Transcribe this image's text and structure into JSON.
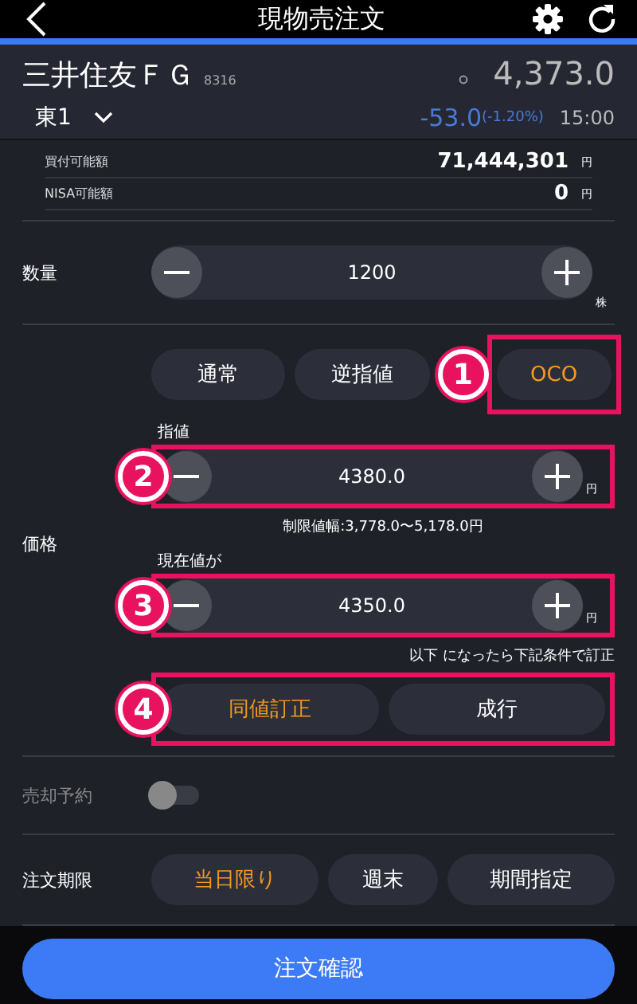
{
  "header": {
    "title": "現物売注文"
  },
  "stock": {
    "name": "三井住友ＦＧ",
    "code": "8316",
    "price": "4,373.0",
    "market": "東1",
    "change": "-53.0",
    "change_pct": "(-1.20%)",
    "time": "15:00"
  },
  "balances": [
    {
      "label": "買付可能額",
      "value": "71,444,301",
      "unit": "円"
    },
    {
      "label": "NISA可能額",
      "value": "0",
      "unit": "円"
    }
  ],
  "quantity": {
    "label": "数量",
    "value": "1200",
    "unit": "株"
  },
  "price": {
    "label": "価格",
    "order_types": [
      {
        "label": "通常",
        "selected": false
      },
      {
        "label": "逆指値",
        "selected": false
      },
      {
        "label": "OCO",
        "selected": true
      }
    ],
    "order_types_callout": "1",
    "limit": {
      "label": "指値",
      "value": "4380.0",
      "unit": "円",
      "callout": "2"
    },
    "range_note": "制限値幅:3,778.0〜5,178.0円",
    "trigger": {
      "label": "現在値が",
      "value": "4350.0",
      "unit": "円",
      "callout": "3"
    },
    "trigger_note": "以下 になったら下記条件で訂正",
    "modes": [
      {
        "label": "同値訂正",
        "selected": true
      },
      {
        "label": "成行",
        "selected": false
      }
    ],
    "modes_callout": "4"
  },
  "reservation": {
    "label": "売却予約",
    "on": false
  },
  "expiry": {
    "label": "注文期限",
    "options": [
      {
        "label": "当日限り",
        "selected": true
      },
      {
        "label": "週末",
        "selected": false
      },
      {
        "label": "期間指定",
        "selected": false
      }
    ]
  },
  "submit": "注文確認"
}
